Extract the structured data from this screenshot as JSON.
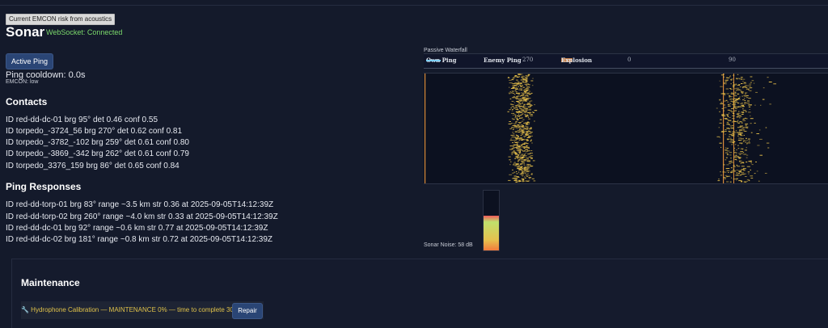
{
  "tooltip": "Current EMCON risk from acoustics",
  "header": {
    "title": "Sonar",
    "ws_status": "WebSocket: Connected"
  },
  "controls": {
    "ping_label": "Active Ping",
    "cooldown": "Ping cooldown: 0.0s",
    "emcon": "EMCON: low"
  },
  "contacts": {
    "heading": "Contacts",
    "items": [
      "ID red-dd-dc-01 brg 95° det 0.46 conf 0.55",
      "ID torpedo_-3724_56 brg 270° det 0.62 conf 0.81",
      "ID torpedo_-3782_-102 brg 259° det 0.61 conf 0.80",
      "ID torpedo_-3869_-342 brg 262° det 0.61 conf 0.79",
      "ID torpedo_3376_159 brg 86° det 0.65 conf 0.84"
    ]
  },
  "ping_responses": {
    "heading": "Ping Responses",
    "items": [
      "ID red-dd-torp-01 brg 83° range ~3.5 km str 0.36 at 2025-09-05T14:12:39Z",
      "ID red-dd-torp-02 brg 260° range ~4.0 km str 0.33 at 2025-09-05T14:12:39Z",
      "ID red-dd-dc-01 brg 92° range ~0.6 km str 0.77 at 2025-09-05T14:12:39Z",
      "ID red-dd-dc-02 brg 181° range ~0.8 km str 0.72 at 2025-09-05T14:12:39Z"
    ]
  },
  "waterfall": {
    "title": "Passive Waterfall",
    "legend": [
      "Own Ping",
      "Enemy Ping",
      "Explosion"
    ],
    "ticks": [
      "270",
      "0",
      "90"
    ],
    "colors": {
      "trace": "#e8c14a",
      "own_ping": "#7fd0ff",
      "explosion": "#f29a52",
      "bearing_line": "#d98a3a"
    }
  },
  "noise": {
    "label": "Sonar Noise: 58 dB",
    "level_fraction": 0.58
  },
  "maintenance": {
    "heading": "Maintenance",
    "item": "🔧 Hydrophone Calibration — MAINTENANCE 0% — time to complete 30s",
    "repair_label": "Repair"
  }
}
